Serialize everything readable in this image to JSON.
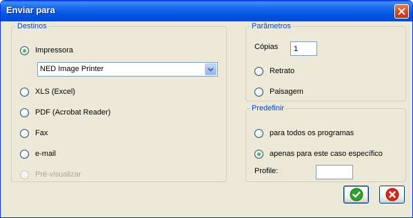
{
  "window": {
    "title": "Enviar para"
  },
  "destinos": {
    "legend": "Destinos",
    "options": [
      {
        "label": "Impressora",
        "checked": true,
        "disabled": false
      },
      {
        "label": "XLS (Excel)",
        "checked": false,
        "disabled": false
      },
      {
        "label": "PDF (Acrobat Reader)",
        "checked": false,
        "disabled": false
      },
      {
        "label": "Fax",
        "checked": false,
        "disabled": false
      },
      {
        "label": "e-mail",
        "checked": false,
        "disabled": false
      },
      {
        "label": "Pré-visualizar",
        "checked": false,
        "disabled": true
      }
    ],
    "printer_select": {
      "value": "NED Image Printer"
    }
  },
  "parametros": {
    "legend": "Parâmetros",
    "copias_label": "Cópias",
    "copias_value": "1",
    "orientation": [
      {
        "label": "Retrato",
        "checked": false
      },
      {
        "label": "Paisagem",
        "checked": false
      }
    ]
  },
  "predefinir": {
    "legend": "Predefinir",
    "options": [
      {
        "label": "para todos os programas",
        "checked": false
      },
      {
        "label": "apenas para este caso específico",
        "checked": true
      }
    ],
    "profile_label": "Profile:",
    "profile_value": ""
  },
  "buttons": {
    "ok_icon": "green-check-icon",
    "cancel_icon": "red-x-icon",
    "accent_ok": "#2ea02e",
    "accent_cancel": "#d42a1c"
  }
}
